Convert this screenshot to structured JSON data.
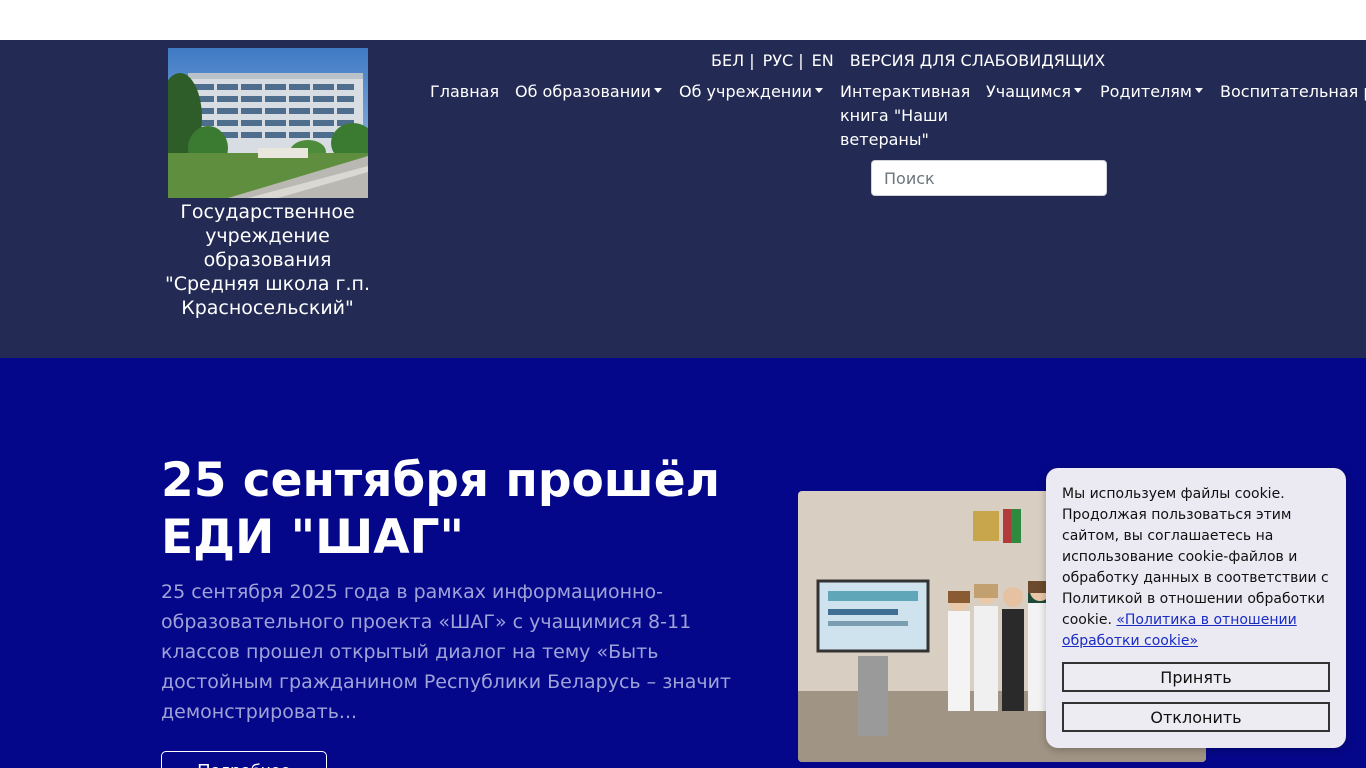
{
  "header": {
    "school_name": "Государственное учреждение образования \"Средняя школа г.п. Красносельский\"",
    "languages": [
      {
        "label": "БЕЛ |"
      },
      {
        "label": "РУС |"
      },
      {
        "label": "EN"
      }
    ],
    "low_vision_label": "ВЕРСИЯ ДЛЯ СЛАБОВИДЯЩИХ",
    "nav": [
      {
        "label": "Главная",
        "dropdown": false
      },
      {
        "label": "Об образовании",
        "dropdown": true
      },
      {
        "label": "Об учреждении",
        "dropdown": true
      },
      {
        "label": "Интерактивная книга \"Наши ветераны\"",
        "dropdown": false
      },
      {
        "label": "Учащимся",
        "dropdown": true
      },
      {
        "label": "Родителям",
        "dropdown": true
      },
      {
        "label": "Воспитательная работа",
        "dropdown": true
      }
    ],
    "search_placeholder": "Поиск"
  },
  "hero": {
    "title": "25 сентября прошёл ЕДИ \"ШАГ\"",
    "text": "25 сентября 2025 года в рамках информационно-образовательного проекта «ШАГ» с учащимися 8-11 классов   прошел открытый диалог на тему «Быть достойным гражданином Республики Беларусь – значит демонстрировать...",
    "button_label": "Подробнее"
  },
  "cookie": {
    "text": "Мы используем файлы cookie. Продолжая пользоваться этим сайтом, вы соглашаетесь на использование cookie-файлов и обработку данных в соответствии с Политикой в отношении обработки cookie. ",
    "link_label": "«Политика в отношении обработки cookie»",
    "accept_label": "Принять",
    "decline_label": "Отклонить"
  },
  "colors": {
    "header_bg": "#232b55",
    "hero_bg": "#05078a",
    "cookie_bg": "#ebeaf3"
  }
}
